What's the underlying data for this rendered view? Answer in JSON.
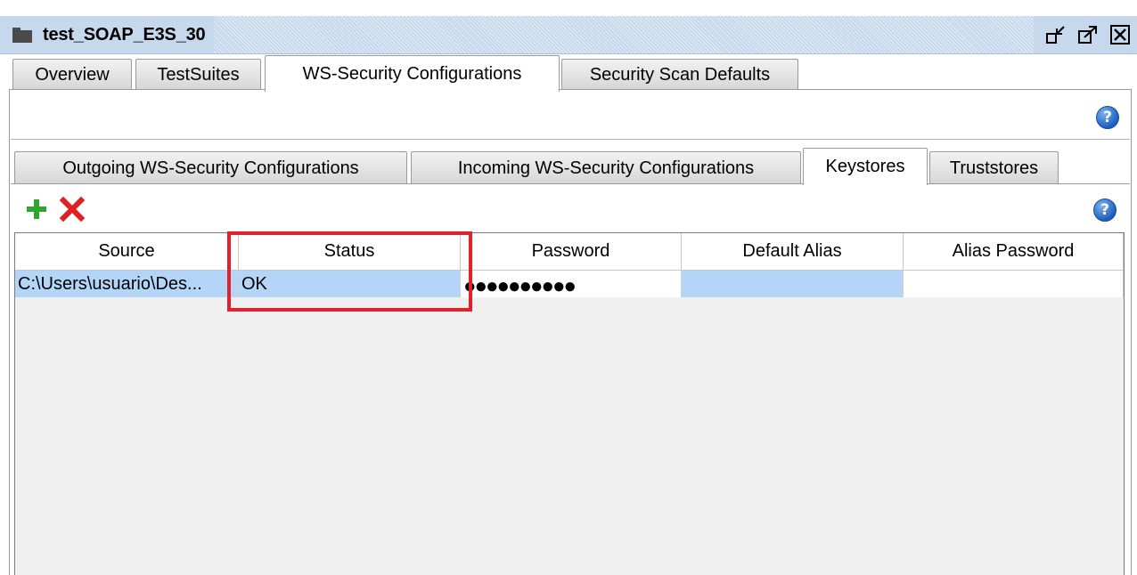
{
  "window": {
    "title": "test_SOAP_E3S_30",
    "buttons": [
      "restore-icon",
      "maximize-icon",
      "close-icon"
    ]
  },
  "outer_tabs": [
    {
      "label": "Overview",
      "active": false
    },
    {
      "label": "TestSuites",
      "active": false
    },
    {
      "label": "WS-Security Configurations",
      "active": true
    },
    {
      "label": "Security Scan Defaults",
      "active": false
    }
  ],
  "inner_tabs": [
    {
      "label": "Outgoing WS-Security Configurations",
      "active": false
    },
    {
      "label": "Incoming WS-Security Configurations",
      "active": false
    },
    {
      "label": "Keystores",
      "active": true
    },
    {
      "label": "Truststores",
      "active": false
    }
  ],
  "help_symbol": "?",
  "toolbar": {
    "add_icon": "plus-icon",
    "remove_icon": "delete-x-icon"
  },
  "table": {
    "columns": [
      "Source",
      "Status",
      "Password",
      "Default Alias",
      "Alias Password"
    ],
    "rows": [
      {
        "source": "C:\\Users\\usuario\\Des...",
        "status": "OK",
        "password": "●●●●●●●●●●",
        "default_alias": "",
        "alias_password": ""
      }
    ]
  },
  "colors": {
    "titlebar": "#c6d8ec",
    "selection": "#b3d6f8",
    "highlight": "#e3212b",
    "add": "#2fa52f",
    "remove": "#e02020"
  }
}
